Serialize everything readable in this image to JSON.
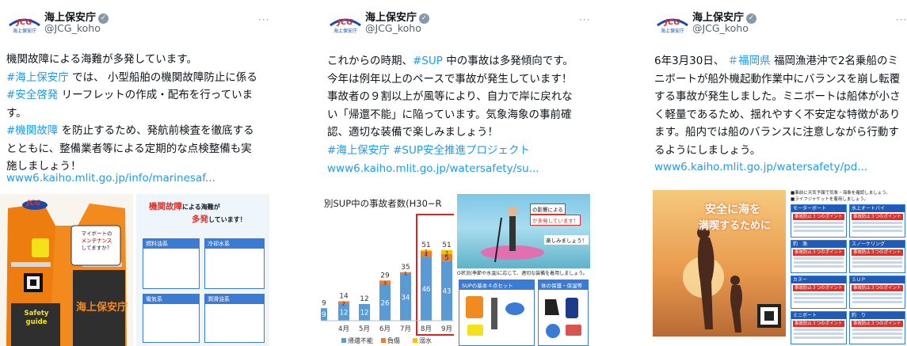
{
  "account": {
    "name": "海上保安庁",
    "handle": "@JCG_koho",
    "verified_glyph": "✓",
    "more_glyph": "···",
    "logo_text": "JCG",
    "logo_sub": "海上保安庁"
  },
  "posts": [
    {
      "lines": [
        [
          "機関故障による海難が多発しています。"
        ],
        [
          {
            "tag": "#海上保安庁"
          },
          " では、 小型船舶の機関故障防止に係る"
        ],
        [
          {
            "tag": "#安全啓発"
          },
          " リーフレットの作成・配布を行っていま"
        ],
        [
          "す。"
        ],
        [
          {
            "tag": "#機関故障"
          },
          " を防止するため、発航前検査を徹底する"
        ],
        [
          "とともに、整備業者等による定期的な点検整備も実"
        ],
        [
          "施しましょう！"
        ]
      ],
      "link": "www6.kaiho.mlit.go.jp/info/marinesaf...",
      "media": {
        "vest_logo": "JCG",
        "vest_badge_line1": "マイボートの",
        "vest_badge_line2": "メンテナンス",
        "vest_badge_line3": "してますか？",
        "vest_label": "Safety guide",
        "vest_org": "海上保安庁",
        "flyer_title_red": "機関故障",
        "flyer_title_rest": "による海難が",
        "flyer_title_red2": "多発",
        "flyer_title_rest2": "しています！",
        "flyer_box1": "燃料油系",
        "flyer_box2": "冷却水系",
        "flyer_box3": "電気系",
        "flyer_box4": "潤滑油系"
      }
    },
    {
      "lines": [
        [
          "これからの時期、",
          {
            "tag": "#SUP"
          },
          " 中の事故は多発傾向です。"
        ],
        [
          "今年は例年以上のペースで事故が発生しています！"
        ],
        [
          "事故者の９割以上が風等により、自力で岸に戻れな"
        ],
        [
          "い「帰還不能」に陥っています。気象海象の事前確"
        ],
        [
          "認、適切な装備で楽しみましょう！"
        ],
        [
          {
            "tag": "#海上保安庁"
          },
          " ",
          {
            "tag": "#SUP安全推進プロジェクト"
          }
        ]
      ],
      "link": "www6.kaiho.mlit.go.jp/watersafety/su...",
      "media": {
        "chart_title": "別SUP中の事故者数(H30~R",
        "photo_caption1": "の影響による",
        "photo_caption2": "が多発しています！",
        "photo_caption3": "楽しみましょう！",
        "gear_caption": "O状況(季節や水温)に応じて、適切な装備を着用しましょう。",
        "gear_title": "SUPの基本４点セット",
        "gear_title2": "体の保護・保温等"
      }
    },
    {
      "lines": [
        [
          "6年3月30日、 ",
          {
            "tag": "＃福岡県"
          },
          " 福岡漁港沖で2名乗船のミ"
        ],
        [
          "ニボートが船外機起動作業中にバランスを崩し転覆"
        ],
        [
          "する事故が発生しました。ミニボートは船体が小さ"
        ],
        [
          "く軽量であるため、揺れやすく不安定な特徴があり"
        ],
        [
          "ます。船内では船のバランスに注意しながら行動す"
        ],
        [
          "るようにしましょう。"
        ]
      ],
      "link": "www6.kaiho.mlit.go.jp/watersafety/pd...",
      "media": {
        "poster_line1": "安全に海を",
        "poster_line2": "満喫するために",
        "sheet_header": "■事前に天気予報で気象・海象を確認しましょう。",
        "sheet_header2": "■ライフジャケットを着用しましょう。",
        "sheet_items": [
          "モーターボート",
          "水上オートバイ",
          "釣　漁",
          "スノーケリング",
          "カヌー",
          "ＳＵＰ",
          "ミニボート",
          "釣　り"
        ],
        "sheet_point": "事故防止３つのポイント"
      }
    }
  ],
  "chart_data": {
    "type": "bar",
    "title": "別SUP中の事故者数(H30~R",
    "categories": [
      "4月",
      "5月",
      "6月",
      "7月",
      "8月",
      "9月"
    ],
    "series": [
      {
        "name": "帰還不能",
        "values": [
          12,
          12,
          26,
          34,
          46,
          43
        ]
      },
      {
        "name": "負傷",
        "values": [
          2,
          0,
          3,
          1,
          4,
          5
        ]
      },
      {
        "name": "溺水",
        "values": [
          0,
          0,
          0,
          0,
          1,
          3
        ]
      }
    ],
    "totals": [
      14,
      12,
      29,
      35,
      51,
      51
    ],
    "partial_category": {
      "total": 9,
      "value": 9
    },
    "highlight": [
      "8月",
      "9月"
    ],
    "colors": {
      "帰還不能": "#5b9bd5",
      "負傷": "#ed7d31",
      "溺水": "#ffc000",
      "highlight": "#e02020"
    },
    "legend_position": "bottom"
  }
}
